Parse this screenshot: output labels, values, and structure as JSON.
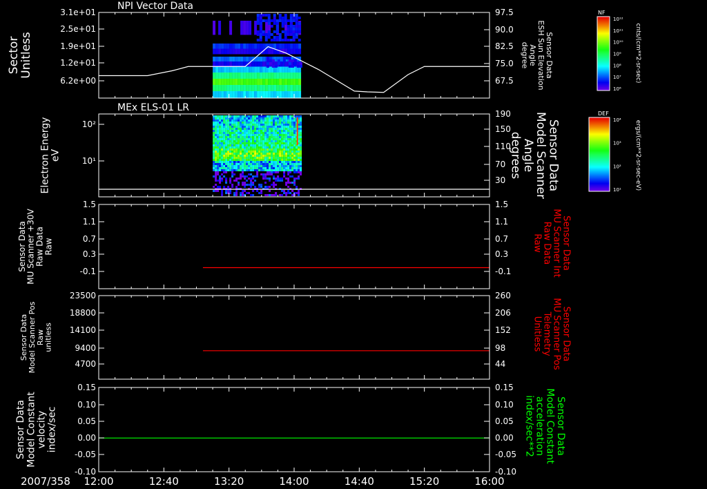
{
  "figure": {
    "date_label": "2007/358",
    "x_ticks": [
      "12:00",
      "12:40",
      "13:20",
      "14:00",
      "14:40",
      "15:20",
      "16:00"
    ]
  },
  "chart_data": [
    {
      "type": "heatmap",
      "title": "NPI Vector Data",
      "ylabel": [
        "Sector",
        "Unitless"
      ],
      "y_ticks": [
        "3.1e+01",
        "2.5e+01",
        "1.9e+01",
        "1.2e+01",
        "6.2e+00"
      ],
      "right_ylabel": [
        "Sensor Data",
        "ESH Sun Elevation",
        "Angle",
        "degree"
      ],
      "right_ticks": [
        "97.5",
        "90.0",
        "82.5",
        "75.0",
        "67.5"
      ],
      "colorbar": {
        "label": "NF",
        "unit": "cnts/(cm**2-sr-sec)",
        "ticks": [
          "10¹²",
          "10¹¹",
          "10¹⁰",
          "10⁹",
          "10⁸",
          "10⁷",
          "10⁶"
        ]
      },
      "data_time_range": [
        "13:10",
        "14:04"
      ],
      "overlay_line": {
        "name": "ESH Sun Elevation Angle",
        "x": [
          "12:00",
          "12:30",
          "12:45",
          "12:55",
          "13:30",
          "13:44",
          "13:55",
          "14:15",
          "14:37",
          "14:45",
          "14:55",
          "15:10",
          "15:20",
          "16:00"
        ],
        "y": [
          72.6,
          72.6,
          74.5,
          76.2,
          76.2,
          84.0,
          81.5,
          75.0,
          66.5,
          66.2,
          66.0,
          73.0,
          76.2,
          76.2
        ]
      }
    },
    {
      "type": "heatmap",
      "title": "MEx ELS-01 LR",
      "ylabel": [
        "Electron Energy",
        "eV"
      ],
      "y_ticks": [
        "10²",
        "10¹"
      ],
      "right_ylabel": [
        "Sensor Data",
        "Model Scanner",
        "Angle",
        "degrees"
      ],
      "right_ticks": [
        "190",
        "150",
        "110",
        "70",
        "30"
      ],
      "colorbar": {
        "label": "DEF",
        "unit": "ergs/(cm**2-sr-sec-eV)",
        "ticks": [
          "10⁴",
          "10³",
          "10²",
          "10¹"
        ]
      },
      "data_time_range": [
        "13:10",
        "14:04"
      ],
      "overlay_line": {
        "name": "Model Scanner Angle",
        "x": [
          "12:00",
          "16:00"
        ],
        "y": [
          12,
          12
        ]
      }
    },
    {
      "type": "line",
      "ylabel": [
        "Sensor Data",
        "MU Scanner +30V",
        "Raw Data",
        "Raw"
      ],
      "y_ticks": [
        "1.5",
        "1.1",
        "0.7",
        "0.3",
        "-0.1"
      ],
      "right_ylabel": [
        "Sensor Data",
        "MU Scanner Int",
        "Raw Data",
        "Raw"
      ],
      "right_ticks": [
        "1.5",
        "1.1",
        "0.7",
        "0.3",
        "-0.1"
      ],
      "ylim": [
        -0.5,
        1.5
      ],
      "series": [
        {
          "color": "#ff0000",
          "x": [
            "13:04",
            "16:00"
          ],
          "y": [
            0,
            0
          ]
        }
      ]
    },
    {
      "type": "line",
      "ylabel": [
        "Sensor Data",
        "Model Scanner Pos",
        "Raw",
        "unitless"
      ],
      "y_ticks": [
        "23500",
        "18800",
        "14100",
        "9400",
        "4700"
      ],
      "right_ylabel": [
        "Sensor Data",
        "MU Scanner Pos",
        "Telemetry",
        "Unitless"
      ],
      "right_ticks": [
        "260",
        "206",
        "152",
        "98",
        "44"
      ],
      "ylim": [
        0,
        23500
      ],
      "series": [
        {
          "color": "#ff0000",
          "x": [
            "13:04",
            "16:00"
          ],
          "y": [
            8000,
            8000
          ]
        }
      ]
    },
    {
      "type": "line",
      "ylabel": [
        "Sensor Data",
        "Model Constant",
        "velocity",
        "index/sec"
      ],
      "y_ticks": [
        "0.15",
        "0.10",
        "0.05",
        "0.00",
        "-0.05",
        "-0.10"
      ],
      "right_ylabel": [
        "Sensor Data",
        "Model Constant",
        "acceleration",
        "index/sec**2"
      ],
      "right_ticks": [
        "0.15",
        "0.10",
        "0.05",
        "0.00",
        "-0.05",
        "-0.10"
      ],
      "ylim": [
        -0.1,
        0.15
      ],
      "series": [
        {
          "color": "#00ff00",
          "x": [
            "12:00",
            "16:00"
          ],
          "y": [
            0,
            0
          ]
        }
      ]
    }
  ]
}
